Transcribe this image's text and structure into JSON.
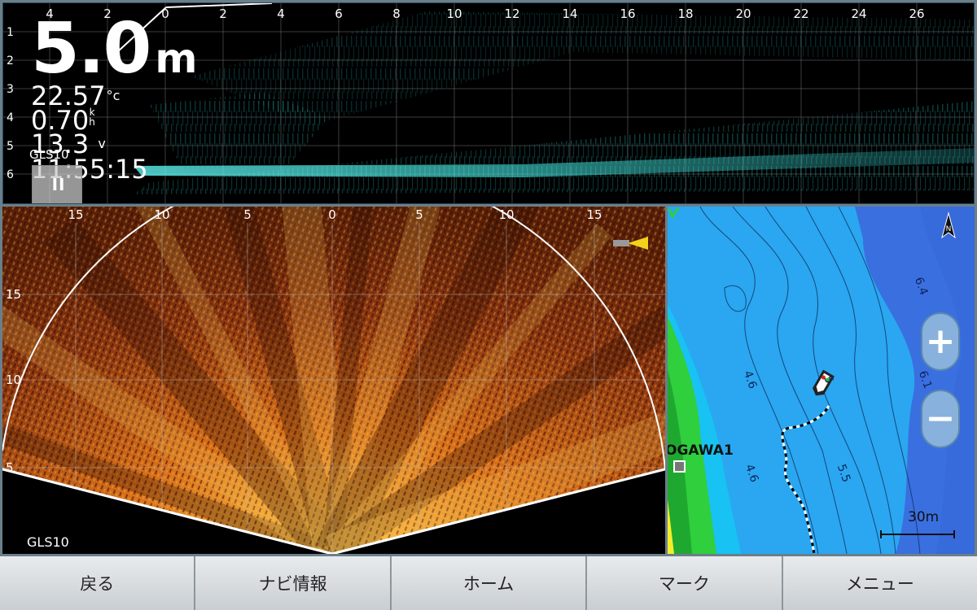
{
  "echogram": {
    "x_ticks": [
      "4",
      "2",
      "0",
      "2",
      "4",
      "6",
      "8",
      "10",
      "12",
      "14",
      "16",
      "18",
      "20",
      "22",
      "24",
      "26"
    ],
    "y_ticks": [
      "1",
      "2",
      "3",
      "4",
      "5",
      "6"
    ],
    "depth_value": "5.0",
    "depth_unit": "m",
    "water_temp": "22.57",
    "water_temp_unit": "°c",
    "speed": "0.70",
    "speed_unit_top": "k",
    "speed_unit_bottom": "h",
    "voltage": "13.3",
    "voltage_unit": "v",
    "time": "11:55:15",
    "device_label": "GLS10",
    "pause_icon": "pause-icon"
  },
  "sonar_fan": {
    "x_ticks": [
      "15",
      "10",
      "5",
      "0",
      "5",
      "10",
      "15"
    ],
    "y_ticks": [
      "15",
      "10",
      "5"
    ],
    "device_label": "GLS10",
    "boat_icon": "boat-direction-icon"
  },
  "chart_map": {
    "depth_contour_labels": [
      "6.4",
      "6.1",
      "4.6",
      "4.6",
      "5.5",
      "5"
    ],
    "waypoint_label": "OGAWA1",
    "scale_label": "30m",
    "zoom_in_label": "+",
    "zoom_out_label": "−",
    "north_icon": "north-arrow-icon",
    "colors": {
      "deep": "#3a6fe0",
      "mid": "#2aa7f0",
      "shallow": "#18c2f2",
      "land": "#2fcf3e"
    }
  },
  "nav": {
    "back": "戻る",
    "navi_info": "ナビ情報",
    "home": "ホーム",
    "mark": "マーク",
    "menu": "メニュー"
  }
}
